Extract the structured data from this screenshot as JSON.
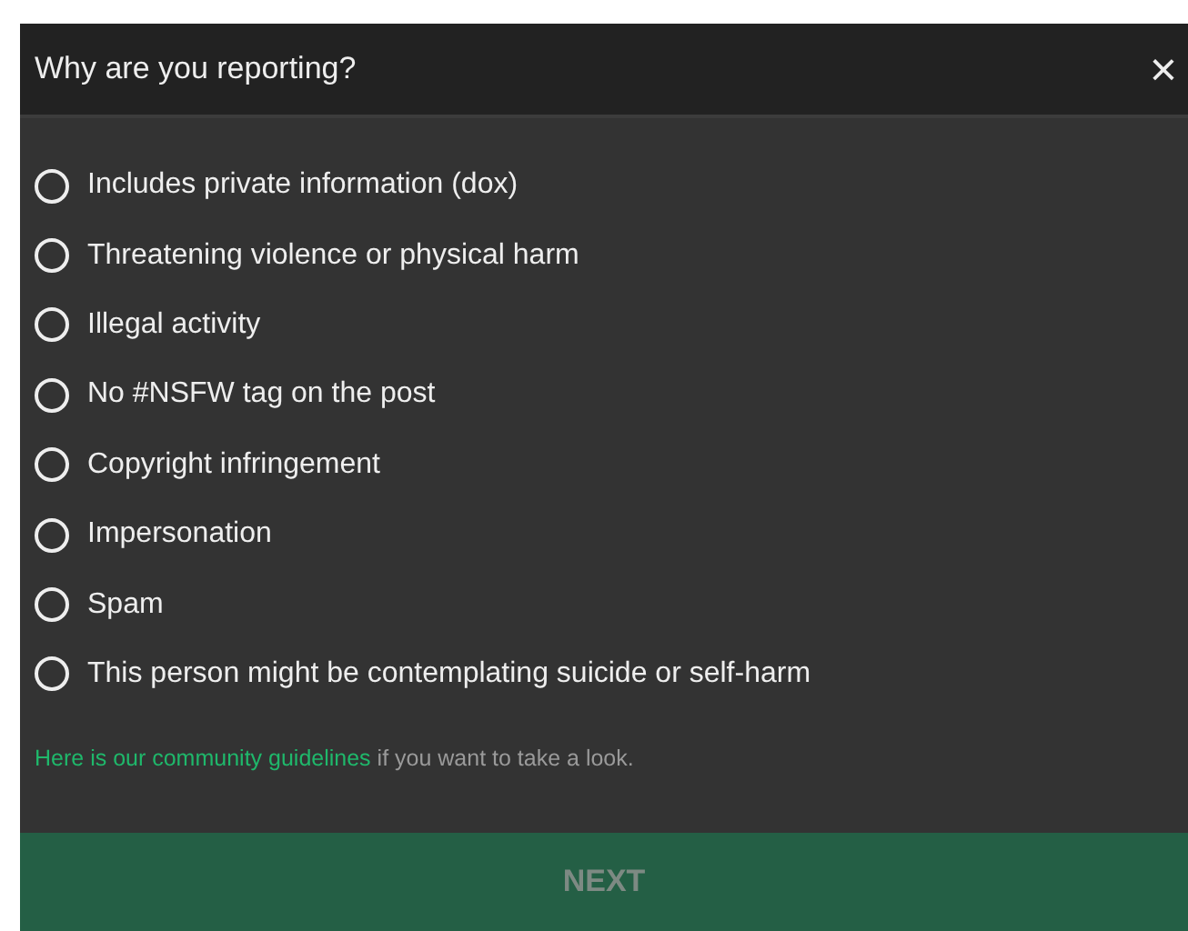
{
  "dialog": {
    "title": "Why are you reporting?",
    "close": "×"
  },
  "options": [
    {
      "label": "Includes private information (dox)",
      "selected": false
    },
    {
      "label": "Threatening violence or physical harm",
      "selected": false
    },
    {
      "label": "Illegal activity",
      "selected": false
    },
    {
      "label": "No #NSFW tag on the post",
      "selected": false
    },
    {
      "label": "Copyright infringement",
      "selected": false
    },
    {
      "label": "Impersonation",
      "selected": false
    },
    {
      "label": "Spam",
      "selected": false
    },
    {
      "label": "This person might be contemplating suicide or self-harm",
      "selected": false
    }
  ],
  "guidelines": {
    "link": "Here is our community guidelines",
    "text": "if you want to take a look."
  },
  "next_button": {
    "label": "NEXT",
    "disabled": true
  }
}
